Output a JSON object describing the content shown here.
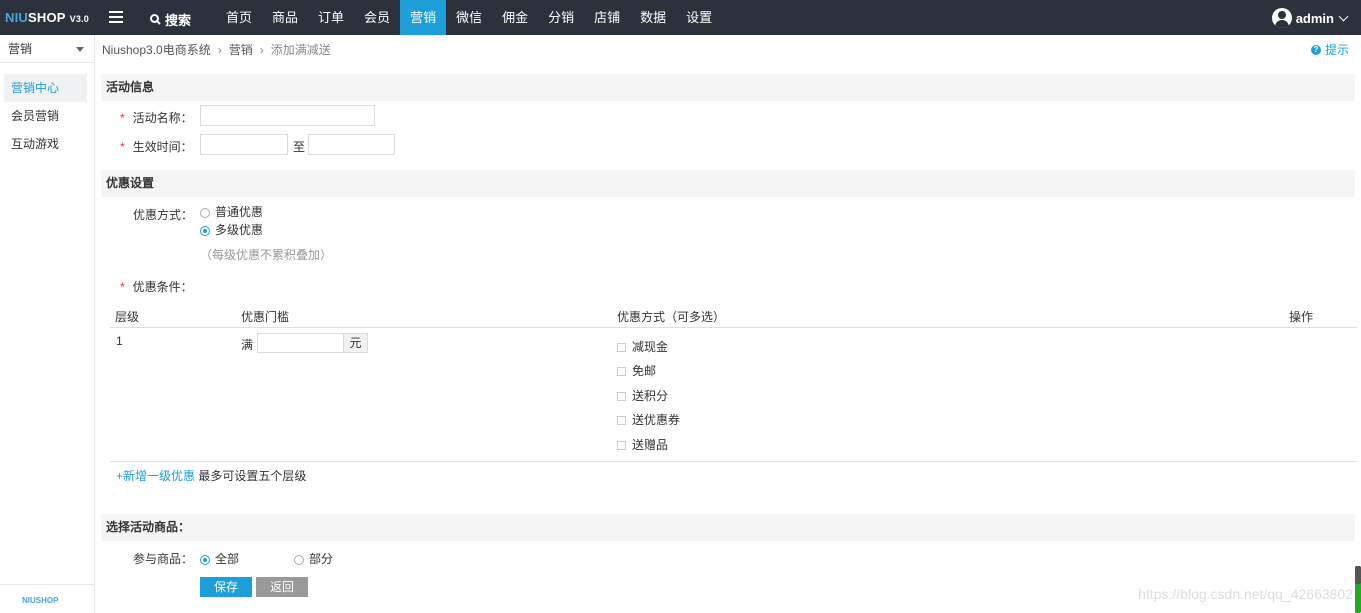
{
  "topbar": {
    "logo_prefix": "NIU",
    "logo_suffix": "SHOP",
    "version": "V3.0",
    "search_label": "搜索",
    "nav": [
      "首页",
      "商品",
      "订单",
      "会员",
      "营销",
      "微信",
      "佣金",
      "分销",
      "店铺",
      "数据",
      "设置"
    ],
    "active_nav": "营销",
    "user": "admin"
  },
  "sidebar": {
    "select_value": "营销",
    "items": [
      "营销中心",
      "会员营销",
      "互动游戏"
    ],
    "active_item": "营销中心",
    "footer_logo": "NIUSHOP"
  },
  "breadcrumb": {
    "items": [
      "Niushop3.0电商系统",
      "营销",
      "添加满减送"
    ],
    "tip": "提示"
  },
  "activity": {
    "section_title": "活动信息",
    "name_label": "活动名称：",
    "time_label": "生效时间：",
    "time_sep": "至"
  },
  "discount": {
    "section_title": "优惠设置",
    "mode_label": "优惠方式：",
    "mode_options": [
      "普通优惠",
      "多级优惠"
    ],
    "mode_selected": "多级优惠",
    "mode_hint": "（每级优惠不累积叠加）",
    "condition_label": "优惠条件：",
    "table_headers": [
      "层级",
      "优惠门槛",
      "优惠方式（可多选）",
      "操作"
    ],
    "row": {
      "level": "1",
      "prefix": "满",
      "unit": "元",
      "options": [
        "减现金",
        "免邮",
        "送积分",
        "送优惠券",
        "送赠品"
      ]
    },
    "add_link": "+新增一级优惠",
    "add_hint": "最多可设置五个层级"
  },
  "goods": {
    "section_title": "选择活动商品：",
    "label": "参与商品：",
    "options": [
      "全部",
      "部分"
    ],
    "selected": "全部"
  },
  "buttons": {
    "save": "保存",
    "back": "返回"
  },
  "watermark": "https://blog.csdn.net/qq_42663802"
}
